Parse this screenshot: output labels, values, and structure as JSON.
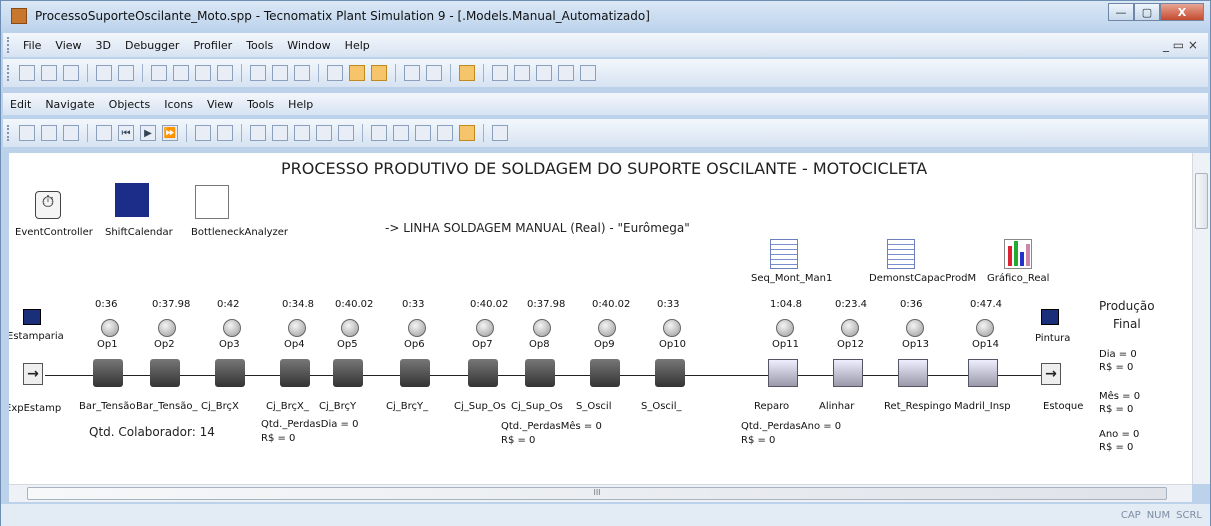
{
  "window": {
    "title": "ProcessoSuporteOscilante_Moto.spp - Tecnomatix Plant Simulation 9 - [.Models.Manual_Automatizado]",
    "min_label": "—",
    "max_label": "▢",
    "close_label": "X",
    "mdi_controls": "_ ▭ ×"
  },
  "menu1": [
    "File",
    "View",
    "3D",
    "Debugger",
    "Profiler",
    "Tools",
    "Window",
    "Help"
  ],
  "menu2": [
    "Edit",
    "Navigate",
    "Objects",
    "Icons",
    "View",
    "Tools",
    "Help"
  ],
  "canvas": {
    "title": "PROCESSO PRODUTIVO DE SOLDAGEM DO SUPORTE OSCILANTE - MOTOCICLETA",
    "subtitle": "-> LINHA SOLDAGEM MANUAL (Real) - \"Eurômega\"",
    "tools": [
      "EventController",
      "ShiftCalendar",
      "BottleneckAnalyzer"
    ],
    "tables": [
      "Seq_Mont_Man1",
      "DemonstCapacProdM",
      "Gráfico_Real"
    ],
    "source_top": "Estamparia",
    "source": "ExpEstamp",
    "sink_top": "Pintura",
    "sink": "Estoque",
    "times": [
      "0:36",
      "0:37.98",
      "0:42",
      "0:34.8",
      "0:40.02",
      "0:33",
      "0:40.02",
      "0:37.98",
      "0:40.02",
      "0:33",
      "1:04.8",
      "0:23.4",
      "0:36",
      "0:47.4"
    ],
    "ops": [
      "Op1",
      "Op2",
      "Op3",
      "Op4",
      "Op5",
      "Op6",
      "Op7",
      "Op8",
      "Op9",
      "Op10",
      "Op11",
      "Op12",
      "Op13",
      "Op14"
    ],
    "stations": [
      "Bar_Tensão",
      "Bar_Tensão_",
      "Cj_BrçX",
      "Cj_BrçX_",
      "Cj_BrçY",
      "Cj_BrçY_",
      "Cj_Sup_Os",
      "Cj_Sup_Os",
      "S_Oscil",
      "S_Oscil_",
      "Reparo",
      "Alinhar",
      "Ret_Respingo",
      "Madril_Insp"
    ],
    "colab": "Qtd. Colaborador: 14",
    "perdas_dia": "Qtd._PerdasDia  =  0",
    "perdas_dia_rs": "R$  =  0",
    "perdas_mes": "Qtd._PerdasMês  =  0",
    "perdas_mes_rs": "R$  =  0",
    "perdas_ano": "Qtd._PerdasAno  =  0",
    "perdas_ano_rs": "R$  =  0",
    "prod_title1": "Produção",
    "prod_title2": "Final",
    "dia": "Dia  =  0",
    "dia_rs": "R$  =  0",
    "mes": "Mês  =  0",
    "mes_rs": "R$  =  0",
    "ano": "Ano  =  0",
    "ano_rs": "R$  =  0"
  },
  "hscroll_label": "III",
  "status": [
    "CAP",
    "NUM",
    "SCRL"
  ]
}
